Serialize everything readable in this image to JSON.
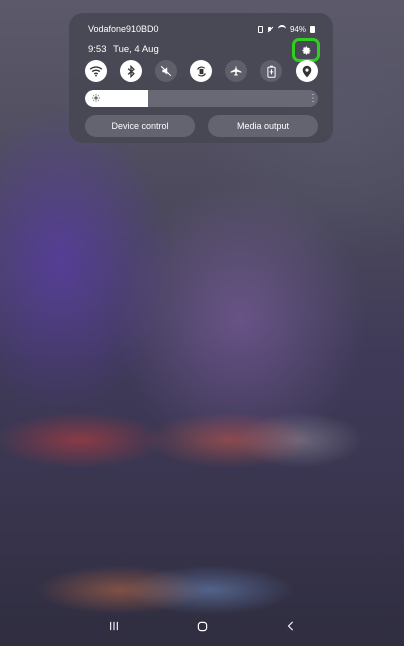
{
  "status_bar": {
    "carrier": "Vodafone910BD0",
    "battery": "94%"
  },
  "panel": {
    "time": "9:53",
    "date": "Tue, 4 Aug"
  },
  "quick_settings": [
    {
      "name": "wifi",
      "state": "on"
    },
    {
      "name": "bluetooth",
      "state": "on"
    },
    {
      "name": "sound-mute",
      "state": "off"
    },
    {
      "name": "auto-rotate",
      "state": "on"
    },
    {
      "name": "airplane-mode",
      "state": "off"
    },
    {
      "name": "power-saving",
      "state": "off"
    },
    {
      "name": "location",
      "state": "on"
    }
  ],
  "brightness": {
    "level": 0.27
  },
  "buttons": {
    "device_control": "Device control",
    "media_output": "Media output"
  },
  "colors": {
    "highlight": "#2fcf1f",
    "panel": "#484854"
  },
  "navigation": [
    "recent-apps-icon",
    "home-icon",
    "back-icon"
  ]
}
